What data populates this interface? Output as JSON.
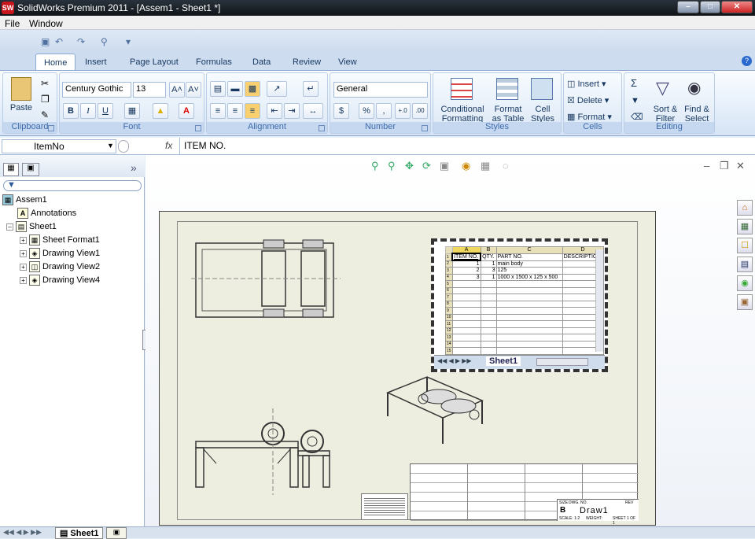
{
  "window": {
    "title": "SolidWorks Premium 2011 - [Assem1 - Sheet1 *]",
    "logo": "SW",
    "controls": {
      "minimize": "–",
      "maximize": "□",
      "close": "✕"
    }
  },
  "menu": {
    "items": [
      "File",
      "Window"
    ]
  },
  "ribbon": {
    "tabs": [
      "Home",
      "Insert",
      "Page Layout",
      "Formulas",
      "Data",
      "Review",
      "View"
    ],
    "active_tab": "Home",
    "groups": {
      "clipboard": {
        "label": "Clipboard",
        "paste": "Paste"
      },
      "font": {
        "label": "Font",
        "font_name": "Century Gothic",
        "font_size": "13",
        "bold": "B",
        "italic": "I",
        "underline": "U",
        "grow": "A˄",
        "shrink": "A˅"
      },
      "alignment": {
        "label": "Alignment"
      },
      "number": {
        "label": "Number",
        "format": "General",
        "currency": "$",
        "percent": "%",
        "comma": ","
      },
      "styles": {
        "label": "Styles",
        "conditional": "Conditional Formatting",
        "format_table": "Format as Table",
        "cell_styles": "Cell Styles"
      },
      "cells": {
        "label": "Cells",
        "insert": "Insert",
        "delete": "Delete",
        "format": "Format"
      },
      "editing": {
        "label": "Editing",
        "sort": "Sort & Filter",
        "find": "Find & Select",
        "sigma": "Σ"
      }
    }
  },
  "formula_bar": {
    "name_box": "ItemNo",
    "fx": "fx",
    "content": "ITEM NO."
  },
  "feature_tree": {
    "items": [
      {
        "label": "Assem1",
        "indent": 0
      },
      {
        "label": "Annotations",
        "indent": 1
      },
      {
        "label": "Sheet1",
        "indent": 1
      },
      {
        "label": "Sheet Format1",
        "indent": 2
      },
      {
        "label": "Drawing View1",
        "indent": 2
      },
      {
        "label": "Drawing View2",
        "indent": 2
      },
      {
        "label": "Drawing View4",
        "indent": 2
      }
    ]
  },
  "bom_table": {
    "col_letters": [
      "A",
      "B",
      "C",
      "D"
    ],
    "headers": [
      "ITEM NO.",
      "QTY.",
      "PART NO.",
      "DESCRIPTION"
    ],
    "rows": [
      [
        "1",
        "1",
        "main body",
        ""
      ],
      [
        "2",
        "3",
        "125",
        ""
      ],
      [
        "3",
        "1",
        "1000 x 1500 x 125 x 500",
        ""
      ]
    ],
    "empty_rows": 11,
    "sheet_tab": "Sheet1"
  },
  "titleblock": {
    "size": "B",
    "dwg_no": "Draw1",
    "size_label": "SIZE",
    "dwg_label": "DWG. NO.",
    "rev_label": "REV",
    "scale": "SCALE: 1:2",
    "weight": "WEIGHT:",
    "sheet": "SHEET 1 OF 1"
  },
  "bottom": {
    "sheet_tab": "Sheet1"
  }
}
